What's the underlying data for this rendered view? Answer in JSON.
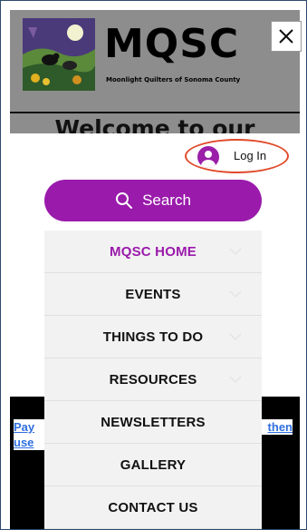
{
  "header": {
    "brand": "MQSC",
    "tagline": "Moonlight Quilters of Sonoma County",
    "logo_icon": "quilt-birds-logo-icon",
    "close_icon": "close-icon"
  },
  "page": {
    "welcome_heading": "Welcome to our",
    "link_left": "Pay",
    "link_left_second": "use",
    "link_right": "then"
  },
  "login": {
    "label": "Log In",
    "icon": "user-avatar-icon"
  },
  "search": {
    "label": "Search",
    "icon": "search-icon"
  },
  "menu": {
    "items": [
      {
        "label": "MQSC HOME",
        "active": true,
        "has_submenu": true
      },
      {
        "label": "EVENTS",
        "active": false,
        "has_submenu": true
      },
      {
        "label": "THINGS TO DO",
        "active": false,
        "has_submenu": true
      },
      {
        "label": "RESOURCES",
        "active": false,
        "has_submenu": true
      },
      {
        "label": "NEWSLETTERS",
        "active": false,
        "has_submenu": false
      },
      {
        "label": "GALLERY",
        "active": false,
        "has_submenu": false
      },
      {
        "label": "CONTACT US",
        "active": false,
        "has_submenu": false
      }
    ]
  },
  "colors": {
    "accent_purple": "#9a1aab",
    "header_grey": "#8d8d8d",
    "login_highlight": "#e04a2a",
    "link_blue": "#2f6fe0"
  }
}
